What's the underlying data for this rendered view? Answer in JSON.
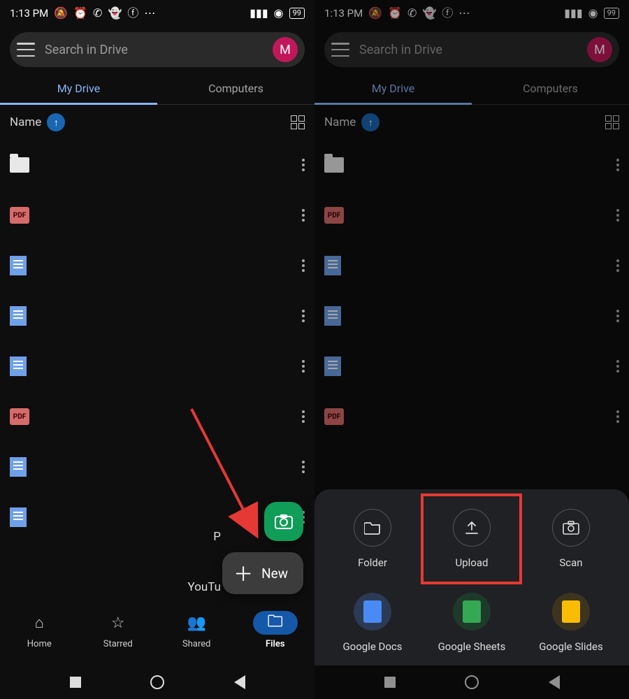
{
  "status": {
    "time": "1:13 PM",
    "battery": "99"
  },
  "search": {
    "placeholder": "Search in Drive",
    "avatar_letter": "M"
  },
  "tabs": {
    "my_drive": "My Drive",
    "computers": "Computers"
  },
  "sort": {
    "label": "Name"
  },
  "files_left": [
    {
      "type": "folder"
    },
    {
      "type": "pdf",
      "label": "PDF"
    },
    {
      "type": "doc"
    },
    {
      "type": "doc"
    },
    {
      "type": "doc"
    },
    {
      "type": "pdf",
      "label": "PDF"
    },
    {
      "type": "doc"
    },
    {
      "type": "doc"
    }
  ],
  "files_right": [
    {
      "type": "folder"
    },
    {
      "type": "pdf",
      "label": "PDF"
    },
    {
      "type": "doc"
    },
    {
      "type": "doc"
    },
    {
      "type": "doc"
    },
    {
      "type": "pdf",
      "label": "PDF"
    }
  ],
  "fab": {
    "new_label": "New"
  },
  "partial": {
    "p1": "P",
    "p2": "YouTu"
  },
  "bottom_nav": {
    "home": "Home",
    "starred": "Starred",
    "shared": "Shared",
    "files": "Files"
  },
  "sheet": {
    "folder": "Folder",
    "upload": "Upload",
    "scan": "Scan",
    "docs": "Google Docs",
    "sheets": "Google Sheets",
    "slides": "Google Slides"
  }
}
